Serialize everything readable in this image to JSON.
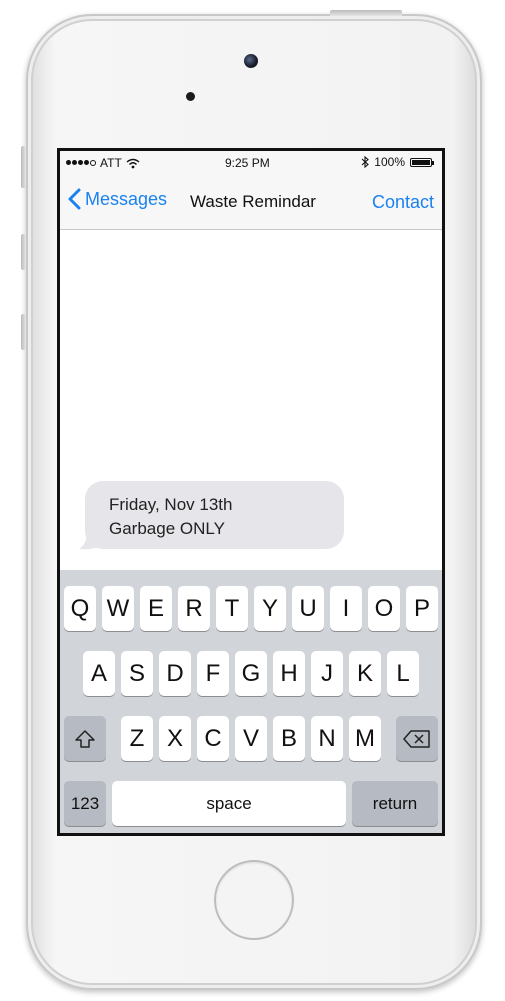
{
  "status_bar": {
    "carrier": "ATT",
    "time": "9:25 PM",
    "battery": "100%"
  },
  "nav": {
    "back_label": "Messages",
    "title": "Waste Remindar",
    "right_label": "Contact"
  },
  "message": {
    "line1": "Friday, Nov 13th",
    "line2": "Garbage ONLY"
  },
  "keyboard": {
    "row1": [
      "Q",
      "W",
      "E",
      "R",
      "T",
      "Y",
      "U",
      "I",
      "O",
      "P"
    ],
    "row2": [
      "A",
      "S",
      "D",
      "F",
      "G",
      "H",
      "J",
      "K",
      "L"
    ],
    "row3": [
      "Z",
      "X",
      "C",
      "V",
      "B",
      "N",
      "M"
    ],
    "numbers_label": "123",
    "space_label": "space",
    "return_label": "return"
  },
  "colors": {
    "accent": "#1a82f0",
    "bubble": "#e5e5ea",
    "keyboard_bg": "#d1d4d9"
  },
  "icons": {
    "back": "chevron-left-icon",
    "wifi": "wifi-icon",
    "bluetooth": "bluetooth-icon",
    "shift": "shift-icon",
    "delete": "delete-icon"
  }
}
